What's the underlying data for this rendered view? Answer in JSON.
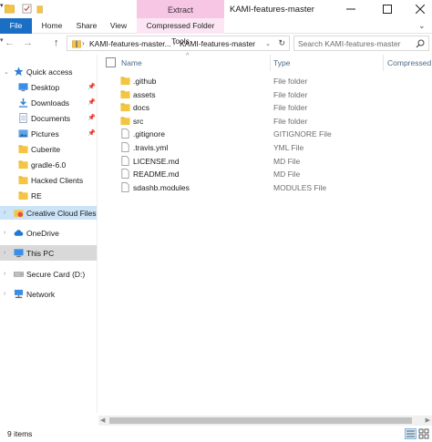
{
  "titlebar": {
    "contextual_group_label": "Extract",
    "window_title": "KAMI-features-master"
  },
  "ribbon": {
    "tabs": [
      {
        "label": "File"
      },
      {
        "label": "Home"
      },
      {
        "label": "Share"
      },
      {
        "label": "View"
      },
      {
        "label": "Compressed Folder Tools"
      }
    ]
  },
  "address": {
    "breadcrumbs": [
      "KAMI-features-master...",
      "KAMI-features-master"
    ]
  },
  "search": {
    "placeholder": "Search KAMI-features-master"
  },
  "nav": {
    "items": [
      {
        "label": "Quick access"
      },
      {
        "label": "Desktop"
      },
      {
        "label": "Downloads"
      },
      {
        "label": "Documents"
      },
      {
        "label": "Pictures"
      },
      {
        "label": "Cuberite"
      },
      {
        "label": "gradle-6.0"
      },
      {
        "label": "Hacked Clients"
      },
      {
        "label": "RE"
      },
      {
        "label": "Creative Cloud Files"
      },
      {
        "label": "OneDrive"
      },
      {
        "label": "This PC"
      },
      {
        "label": "Secure Card (D:)"
      },
      {
        "label": "Network"
      }
    ]
  },
  "columns": {
    "name": "Name",
    "type": "Type",
    "compressed": "Compressed"
  },
  "files": [
    {
      "name": ".github",
      "type": "File folder"
    },
    {
      "name": "assets",
      "type": "File folder"
    },
    {
      "name": "docs",
      "type": "File folder"
    },
    {
      "name": "src",
      "type": "File folder"
    },
    {
      "name": ".gitignore",
      "type": "GITIGNORE File"
    },
    {
      "name": ".travis.yml",
      "type": "YML File"
    },
    {
      "name": "LICENSE.md",
      "type": "MD File"
    },
    {
      "name": "README.md",
      "type": "MD File"
    },
    {
      "name": "sdashb.modules",
      "type": "MODULES File"
    }
  ],
  "status": {
    "item_count": "9 items"
  },
  "colors": {
    "accent": "#1a6fc4",
    "context_tab": "#f7c6e5",
    "folder": "#f4c542"
  }
}
